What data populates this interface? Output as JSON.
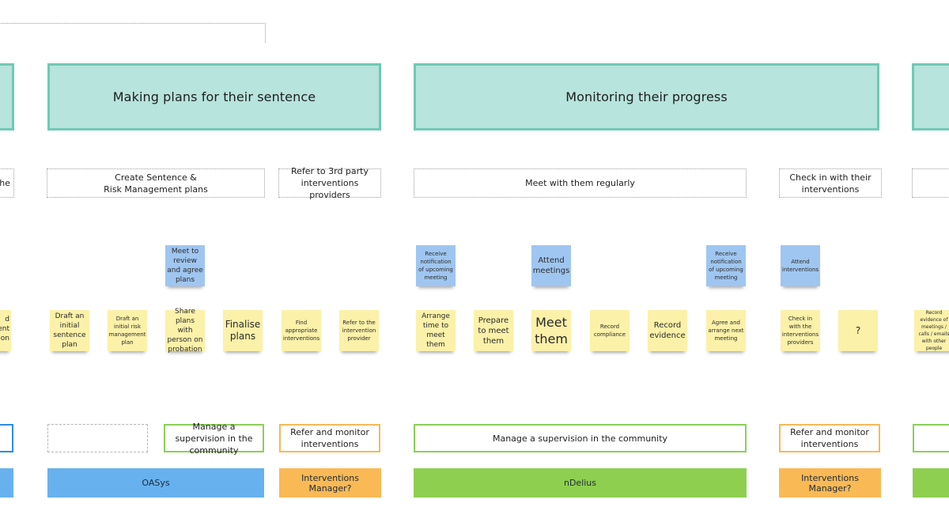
{
  "colors": {
    "stage_fill": "#b7e4dc",
    "stage_border": "#6fc9b6",
    "sticky_yellow": "#fbf1a9",
    "sticky_blue": "#9fc6f0",
    "system_blue": "#67b1ef",
    "system_green": "#8ecf50",
    "system_orange": "#f9b955"
  },
  "stages": [
    {
      "label": ""
    },
    {
      "label": "Making plans for their sentence"
    },
    {
      "label": "Monitoring their progress"
    },
    {
      "label": ""
    }
  ],
  "activities": [
    {
      "label": "the"
    },
    {
      "label": "Create Sentence &\nRisk Management plans"
    },
    {
      "label": "Refer to 3rd party\ninterventions providers"
    },
    {
      "label": "Meet with them regularly"
    },
    {
      "label": "Check in with their\ninterventions"
    },
    {
      "label": ""
    }
  ],
  "user_stickies": [
    {
      "label": "Meet to review and agree plans"
    },
    {
      "label": "Receive notification of upcoming meeting"
    },
    {
      "label": "Attend meetings"
    },
    {
      "label": "Receive notification of upcoming meeting"
    },
    {
      "label": "Attend interventions"
    }
  ],
  "staff_stickies": [
    {
      "label": "d\nent\nion"
    },
    {
      "label": "Draft an initial sentence plan"
    },
    {
      "label": "Draft an initial risk management plan"
    },
    {
      "label": "Share plans with person on probation"
    },
    {
      "label": "Finalise plans"
    },
    {
      "label": "Find appropriate interventions"
    },
    {
      "label": "Refer to the intervention provider"
    },
    {
      "label": "Arrange time to meet them"
    },
    {
      "label": "Prepare to meet them"
    },
    {
      "label": "Meet them"
    },
    {
      "label": "Record compliance"
    },
    {
      "label": "Record evidence"
    },
    {
      "label": "Agree and arrange next meeting"
    },
    {
      "label": "Check in with the interventions providers"
    },
    {
      "label": "?"
    },
    {
      "label": "Record evidence of meetings / calls / emails with other people"
    }
  ],
  "capabilities": [
    {
      "label": ""
    },
    {
      "label": ""
    },
    {
      "label": "Manage a supervision in the community"
    },
    {
      "label": "Refer and monitor interventions"
    },
    {
      "label": "Manage a supervision in the community"
    },
    {
      "label": "Refer and monitor interventions"
    },
    {
      "label": ""
    }
  ],
  "systems": [
    {
      "label": ""
    },
    {
      "label": "OASys"
    },
    {
      "label": "Interventions Manager?"
    },
    {
      "label": "nDelius"
    },
    {
      "label": "Interventions Manager?"
    },
    {
      "label": ""
    }
  ]
}
